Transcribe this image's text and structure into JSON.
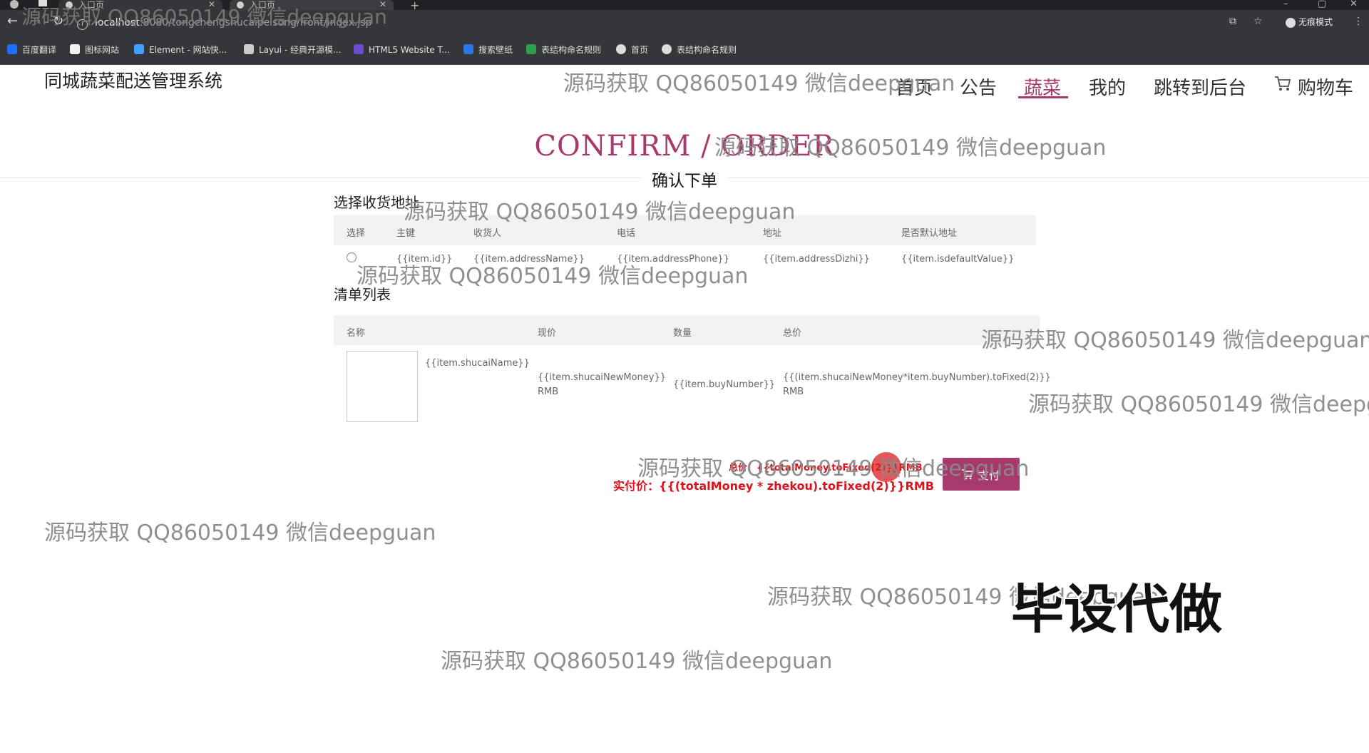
{
  "browser": {
    "tabs": [
      {
        "label": "入口页"
      },
      {
        "label": "入口页"
      }
    ],
    "new_tab": "+",
    "url_host": "localhost",
    "url_path": ":8080/tongchengshucaipeisong/front/index.jsp",
    "incognito_label": "无痕模式",
    "bookmarks": [
      {
        "label": "百度翻译",
        "color": "#1e6fff"
      },
      {
        "label": "图标网站",
        "color": "#f2f2f2"
      },
      {
        "label": "Element - 网站快...",
        "color": "#409eff"
      },
      {
        "label": "Layui - 经典开源模...",
        "color": "#cccccc"
      },
      {
        "label": "HTML5 Website T...",
        "color": "#6a4ccf"
      },
      {
        "label": "搜索壁纸",
        "color": "#2b76e5"
      },
      {
        "label": "表结构命名规则",
        "color": "#2e9e4a"
      },
      {
        "label": "首页",
        "color": "#dddddd"
      },
      {
        "label": "表结构命名规则",
        "color": "#dddddd"
      }
    ]
  },
  "site": {
    "title": "同城蔬菜配送管理系统",
    "nav": [
      {
        "label": "首页"
      },
      {
        "label": "公告"
      },
      {
        "label": "蔬菜",
        "active": true
      },
      {
        "label": "我的"
      },
      {
        "label": "跳转到后台"
      },
      {
        "label": "购物车"
      }
    ],
    "accent_color": "#a8396c"
  },
  "page": {
    "heading": "CONFIRM / ORDER",
    "subtitle": "确认下单",
    "address_section": {
      "label": "选择收货地址",
      "columns": [
        "选择",
        "主键",
        "收货人",
        "电话",
        "地址",
        "是否默认地址"
      ],
      "row": [
        "{{item.id}}",
        "{{item.addressName}}",
        "{{item.addressPhone}}",
        "{{item.addressDizhi}}",
        "{{item.isdefaultValue}}"
      ]
    },
    "order_section": {
      "label": "清单列表",
      "columns": [
        "名称",
        "现价",
        "数量",
        "总价"
      ],
      "row": {
        "name": "{{item.shucaiName}}",
        "price_line1": "{{item.shucaiNewMoney}}",
        "price_line2": "RMB",
        "quantity": "{{item.buyNumber}}",
        "total_line1": "{{(item.shucaiNewMoney*item.buyNumber).toFixed(2)}}",
        "total_line2": "RMB"
      }
    },
    "totals": {
      "total": "总价：{{totalMoney.toFixed(2)}}RMB",
      "actual": "实付价：{{(totalMoney * zhekou).toFixed(2)}}RMB"
    },
    "pay_button": "支付"
  },
  "watermarks": {
    "text": "源码获取 QQ86050149 微信deepguan",
    "big": "毕设代做"
  }
}
